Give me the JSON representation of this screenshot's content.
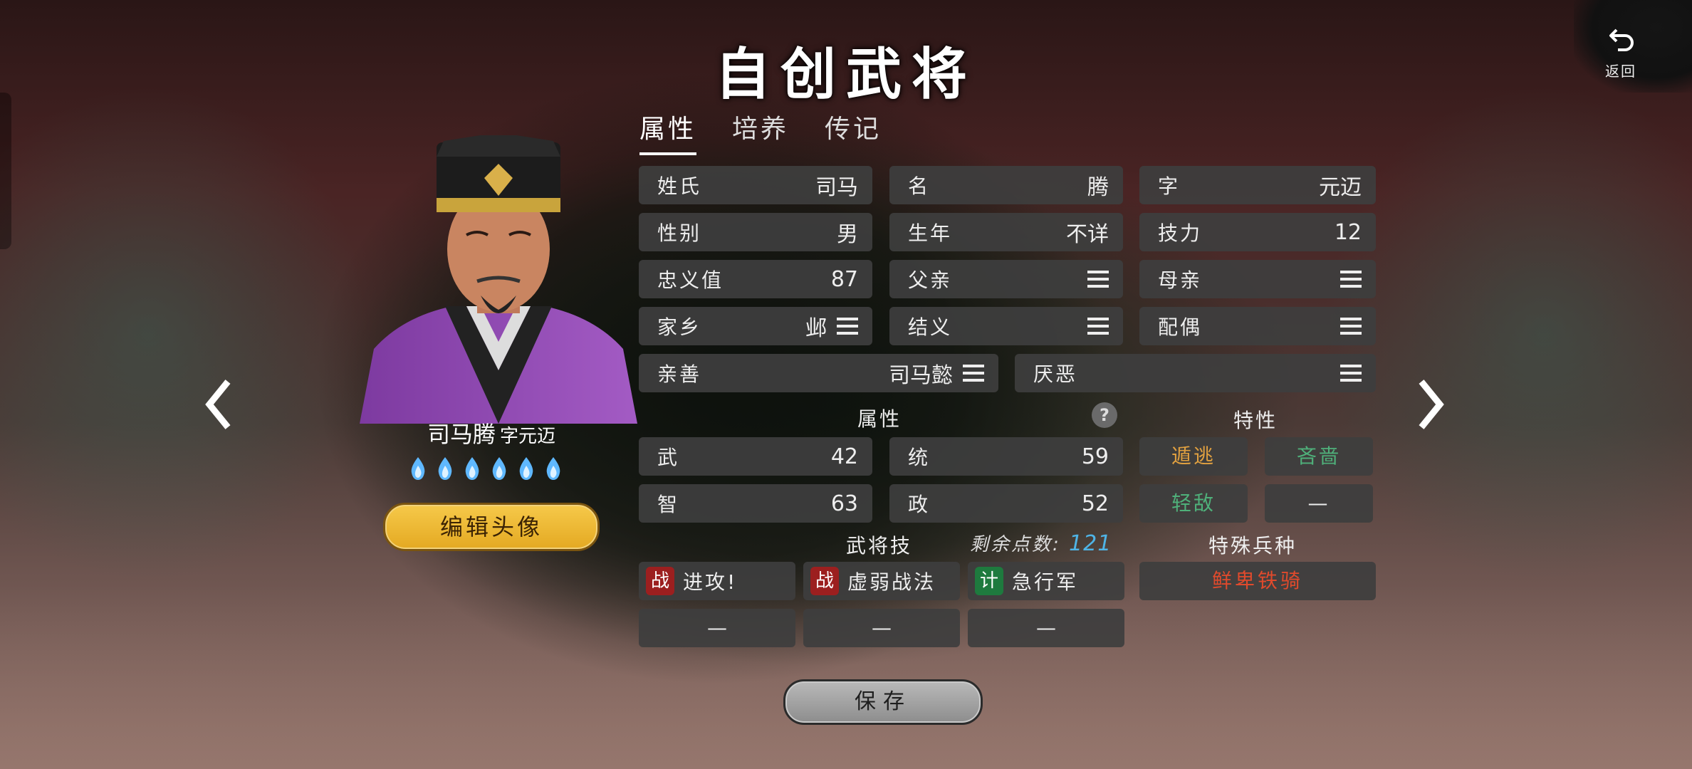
{
  "title": "自创武将",
  "back_label": "返回",
  "tabs": [
    {
      "label": "属性",
      "active": true
    },
    {
      "label": "培养",
      "active": false
    },
    {
      "label": "传记",
      "active": false
    }
  ],
  "character": {
    "name": "司马腾",
    "courtesy": "字元迈",
    "flame_count": 6,
    "edit_avatar_label": "编辑头像"
  },
  "info": {
    "surname": {
      "label": "姓氏",
      "value": "司马"
    },
    "given_name": {
      "label": "名",
      "value": "腾"
    },
    "courtesy": {
      "label": "字",
      "value": "元迈"
    },
    "gender": {
      "label": "性别",
      "value": "男"
    },
    "birth_year": {
      "label": "生年",
      "value": "不详"
    },
    "skill_power": {
      "label": "技力",
      "value": "12"
    },
    "loyalty": {
      "label": "忠义值",
      "value": "87"
    },
    "father": {
      "label": "父亲"
    },
    "mother": {
      "label": "母亲"
    },
    "hometown": {
      "label": "家乡",
      "value": "邺"
    },
    "sworn": {
      "label": "结义"
    },
    "spouse": {
      "label": "配偶"
    },
    "friendly": {
      "label": "亲善",
      "value": "司马懿"
    },
    "disliked": {
      "label": "厌恶"
    }
  },
  "attributes": {
    "heading": "属性",
    "help": "?",
    "war": {
      "label": "武",
      "value": "42"
    },
    "command": {
      "label": "统",
      "value": "59"
    },
    "intellect": {
      "label": "智",
      "value": "63"
    },
    "politics": {
      "label": "政",
      "value": "52"
    }
  },
  "traits": {
    "heading": "特性",
    "items": [
      {
        "label": "遁逃",
        "color": "#e0a040"
      },
      {
        "label": "吝啬",
        "color": "#4fb07a"
      },
      {
        "label": "轻敌",
        "color": "#4fb07a"
      },
      {
        "label": "—",
        "color": "#eeeeee"
      }
    ]
  },
  "skills": {
    "heading": "武将技",
    "points_label": "剩余点数:",
    "points_value": "121",
    "items": [
      {
        "badge": "战",
        "badge_color": "#9c1f1f",
        "label": "进攻!"
      },
      {
        "badge": "战",
        "badge_color": "#9c1f1f",
        "label": "虚弱战法"
      },
      {
        "badge": "计",
        "badge_color": "#1e7a3e",
        "label": "急行军"
      }
    ],
    "empty_slots": [
      "—",
      "—",
      "—"
    ]
  },
  "special_troop": {
    "heading": "特殊兵种",
    "value": "鲜卑铁骑",
    "color": "#e04a2c"
  },
  "save_label": "保存"
}
